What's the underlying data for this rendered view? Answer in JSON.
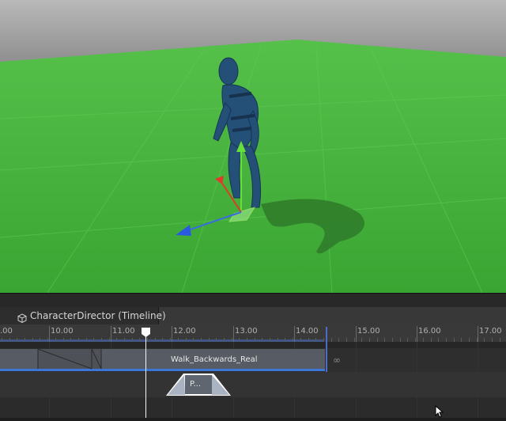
{
  "window": {
    "tab_label": "CharacterDirector (Timeline)",
    "tab_icon": "cube-icon"
  },
  "ruler": {
    "labels": [
      ".00",
      "10.00",
      "11.00",
      "12.00",
      "13.00",
      "14.00",
      "15.00",
      "16.00",
      "17.00"
    ]
  },
  "clips": {
    "walk_label": "Walk_Backwards_Real",
    "p_label": "P..."
  },
  "indicators": {
    "infinity": "∞"
  },
  "colors": {
    "ground": "#44b53c",
    "sky_top": "#b9b9b9",
    "clip_body": "#575b63",
    "clip_selection": "#3c76d6",
    "character": "#244f77"
  }
}
